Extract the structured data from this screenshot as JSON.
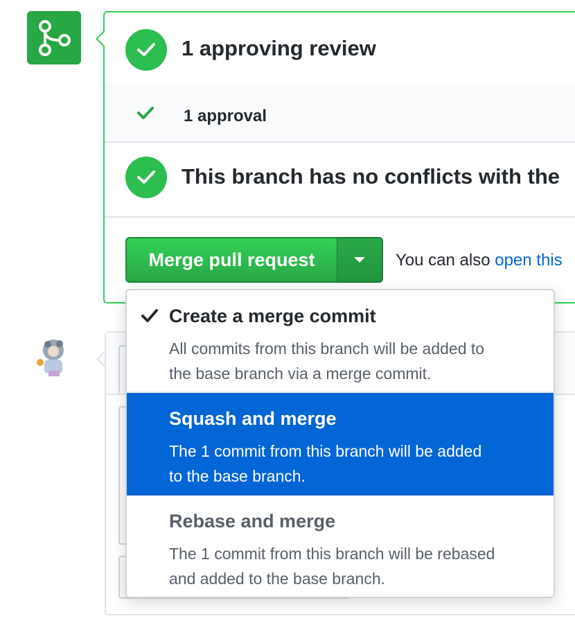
{
  "merge_box": {
    "review_title": "1 approving review",
    "approval_text": "1 approval",
    "conflict_title": "This branch has no conflicts with the",
    "merge_button_label": "Merge pull request",
    "also_text": "You can also ",
    "also_link": "open this"
  },
  "merge_menu": {
    "items": [
      {
        "title": "Create a merge commit",
        "desc_line1": "All commits from this branch will be added to",
        "desc_line2": "the base branch via a merge commit."
      },
      {
        "title": "Squash and merge",
        "desc_line1": "The 1 commit from this branch will be added",
        "desc_line2": "to the base branch."
      },
      {
        "title": "Rebase and merge",
        "desc_line1": "The 1 commit from this branch will be rebased",
        "desc_line2": "and added to the base branch."
      }
    ]
  },
  "colors": {
    "success": "#2cbe4e",
    "merge_green": "#28a745",
    "selected_blue": "#0366d6",
    "link_blue": "#0366d6"
  },
  "icons": {
    "badge": "git-merge-icon",
    "status": "check-circle-icon",
    "approval": "check-icon",
    "dropdown": "triangle-down-icon",
    "selected": "check-icon"
  }
}
